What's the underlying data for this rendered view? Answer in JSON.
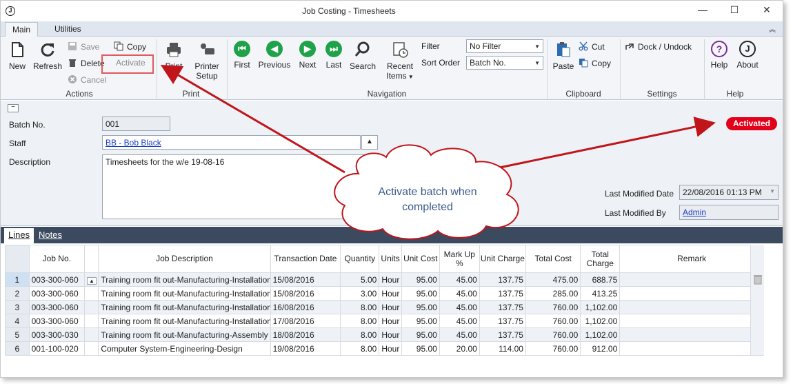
{
  "window": {
    "title": "Job Costing - Timesheets",
    "app_icon": "J",
    "controls": {
      "minimize": "—",
      "maximize": "☐",
      "close": "✕"
    }
  },
  "tabs": [
    {
      "label": "Main",
      "active": true
    },
    {
      "label": "Utilities",
      "active": false
    }
  ],
  "ribbon": {
    "actions": {
      "group_label": "Actions",
      "new": "New",
      "refresh": "Refresh",
      "save": "Save",
      "delete": "Delete",
      "cancel": "Cancel",
      "copy": "Copy",
      "activate": "Activate"
    },
    "print": {
      "group_label": "Print",
      "print": "Print",
      "printer_setup_line1": "Printer",
      "printer_setup_line2": "Setup"
    },
    "navigation": {
      "group_label": "Navigation",
      "first": "First",
      "previous": "Previous",
      "next": "Next",
      "last": "Last",
      "search": "Search",
      "recent_line1": "Recent",
      "recent_line2": "Items",
      "filter_label": "Filter",
      "filter_value": "No Filter",
      "sort_label": "Sort Order",
      "sort_value": "Batch No."
    },
    "clipboard": {
      "group_label": "Clipboard",
      "paste": "Paste",
      "cut": "Cut",
      "copy": "Copy"
    },
    "settings": {
      "group_label": "Settings",
      "dock": "Dock / Undock"
    },
    "help": {
      "group_label": "Help",
      "help": "Help",
      "about": "About"
    }
  },
  "form": {
    "batch_label": "Batch No.",
    "batch_value": "001",
    "staff_label": "Staff",
    "staff_value": "BB - Bob Black",
    "description_label": "Description",
    "description_value": "Timesheets for the w/e 19-08-16",
    "status_badge": "Activated",
    "last_modified_date_label": "Last Modified Date",
    "last_modified_date_value": "22/08/2016 01:13 PM",
    "last_modified_by_label": "Last Modified By",
    "last_modified_by_value": "Admin"
  },
  "callout": {
    "text_line1": "Activate batch when",
    "text_line2": "completed"
  },
  "lines": {
    "tabs": [
      {
        "label": "Lines",
        "active": true
      },
      {
        "label": "Notes",
        "active": false
      }
    ],
    "columns": [
      "Job No.",
      "",
      "Job Description",
      "Transaction Date",
      "Quantity",
      "Units",
      "Unit Cost",
      "Mark Up %",
      "Unit Charge",
      "Total Cost",
      "Total Charge",
      "Remark"
    ],
    "rows": [
      {
        "n": "1",
        "job": "003-300-060",
        "desc": "Training room fit out-Manufacturing-Installation",
        "date": "15/08/2016",
        "qty": "5.00",
        "units": "Hour",
        "ucost": "95.00",
        "markup": "45.00",
        "ucharge": "137.75",
        "tcost": "475.00",
        "tcharge": "688.75",
        "remark": ""
      },
      {
        "n": "2",
        "job": "003-300-060",
        "desc": "Training room fit out-Manufacturing-Installation",
        "date": "15/08/2016",
        "qty": "3.00",
        "units": "Hour",
        "ucost": "95.00",
        "markup": "45.00",
        "ucharge": "137.75",
        "tcost": "285.00",
        "tcharge": "413.25",
        "remark": ""
      },
      {
        "n": "3",
        "job": "003-300-060",
        "desc": "Training room fit out-Manufacturing-Installation",
        "date": "16/08/2016",
        "qty": "8.00",
        "units": "Hour",
        "ucost": "95.00",
        "markup": "45.00",
        "ucharge": "137.75",
        "tcost": "760.00",
        "tcharge": "1,102.00",
        "remark": ""
      },
      {
        "n": "4",
        "job": "003-300-060",
        "desc": "Training room fit out-Manufacturing-Installation",
        "date": "17/08/2016",
        "qty": "8.00",
        "units": "Hour",
        "ucost": "95.00",
        "markup": "45.00",
        "ucharge": "137.75",
        "tcost": "760.00",
        "tcharge": "1,102.00",
        "remark": ""
      },
      {
        "n": "5",
        "job": "003-300-030",
        "desc": "Training room fit out-Manufacturing-Assembly",
        "date": "18/08/2016",
        "qty": "8.00",
        "units": "Hour",
        "ucost": "95.00",
        "markup": "45.00",
        "ucharge": "137.75",
        "tcost": "760.00",
        "tcharge": "1,102.00",
        "remark": ""
      },
      {
        "n": "6",
        "job": "001-100-020",
        "desc": "Computer System-Engineering-Design",
        "date": "19/08/2016",
        "qty": "8.00",
        "units": "Hour",
        "ucost": "95.00",
        "markup": "20.00",
        "ucharge": "114.00",
        "tcost": "760.00",
        "tcharge": "912.00",
        "remark": ""
      }
    ]
  },
  "colors": {
    "accent_red": "#e3001b",
    "nav_green": "#1fa24a",
    "arrow_red": "#c0151b",
    "help_purple": "#7a2a9a"
  }
}
